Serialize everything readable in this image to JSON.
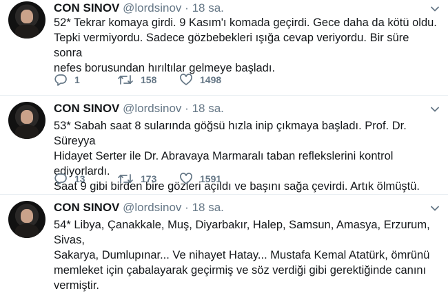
{
  "tweets": [
    {
      "name": "CON SINOV",
      "handle": "@lordsinov",
      "separator": "·",
      "time": "18 sa.",
      "lines": [
        "52* Tekrar komaya girdi. 9 Kasım'ı komada geçirdi. Gece daha da kötü oldu.",
        "Tepki vermiyordu. Sadece gözbebekleri ışığa cevap veriyordu. Bir süre sonra",
        "nefes borusundan hırıltılar gelmeye başladı."
      ],
      "replies": "1",
      "retweets": "158",
      "likes": "1498"
    },
    {
      "name": "CON SINOV",
      "handle": "@lordsinov",
      "separator": "·",
      "time": "18 sa.",
      "lines": [
        "53* Sabah saat 8 sularında göğsü hızla inip çıkmaya başladı. Prof. Dr. Süreyya",
        "Hidayet Serter ile Dr. Abravaya Marmaralı taban reflekslerini kontrol ediyorlardı.",
        "Saat 9 gibi birden bire gözleri açıldı ve başını sağa çevirdi. Artık ölmüştü."
      ],
      "replies": "13",
      "retweets": "173",
      "likes": "1591"
    },
    {
      "name": "CON SINOV",
      "handle": "@lordsinov",
      "separator": "·",
      "time": "18 sa.",
      "lines": [
        "54* Libya, Çanakkale, Muş, Diyarbakır, Halep, Samsun, Amasya, Erzurum, Sivas,",
        "Sakarya, Dumlupınar... Ve nihayet Hatay... Mustafa Kemal Atatürk, ömrünü",
        "memleket için çabalayarak geçirmiş ve söz verdiği gibi gerektiğinde canını",
        "vermiştir."
      ]
    }
  ],
  "icons": {
    "reply": "reply-icon",
    "retweet": "retweet-icon",
    "like": "heart-icon",
    "menu": "chevron-down-icon"
  },
  "colors": {
    "name": "#14171a",
    "meta": "#657786",
    "divider": "#e6ecf0"
  }
}
